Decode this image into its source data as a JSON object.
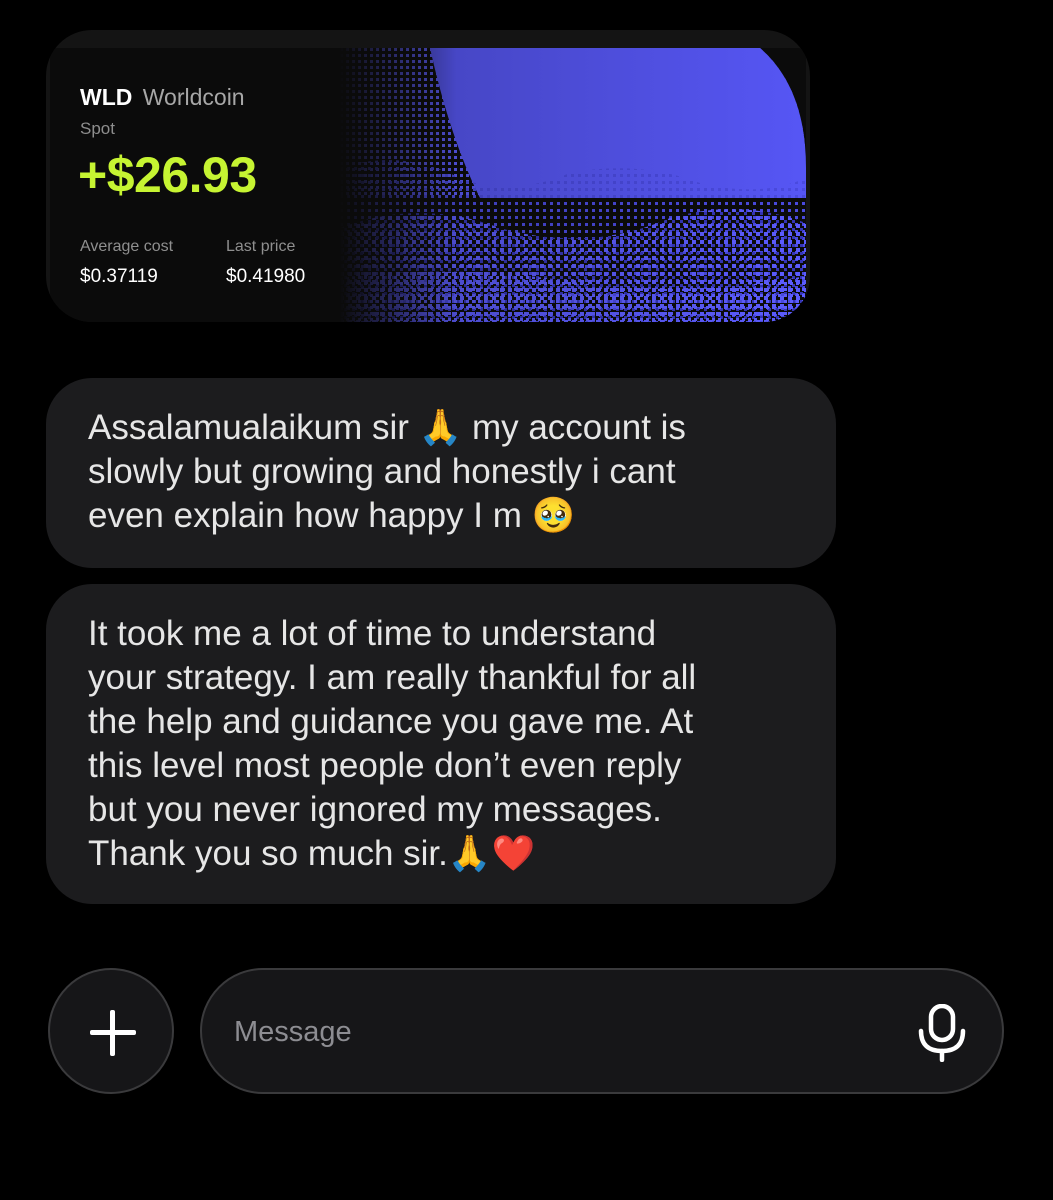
{
  "card": {
    "symbol": "WLD",
    "name": "Worldcoin",
    "market_type": "Spot",
    "pnl": "+$26.93",
    "average_cost_label": "Average cost",
    "average_cost": "$0.37119",
    "last_price_label": "Last price",
    "last_price": "$0.41980",
    "accent_color": "#c6f432",
    "art_color": "#5c5cff"
  },
  "messages": [
    {
      "text": "Assalamualaikum sir 🙏 my account is\nslowly but growing and honestly i cant\neven explain how happy I m 🥹"
    },
    {
      "text": "It took me a lot of time to understand\nyour strategy. I am really thankful for all\nthe help and guidance you gave me. At\nthis level most people don’t even reply\nbut you never ignored my messages.\nThank you so much sir.🙏❤️"
    }
  ],
  "composer": {
    "placeholder": "Message",
    "add_icon": "plus-icon",
    "mic_icon": "microphone-icon"
  }
}
